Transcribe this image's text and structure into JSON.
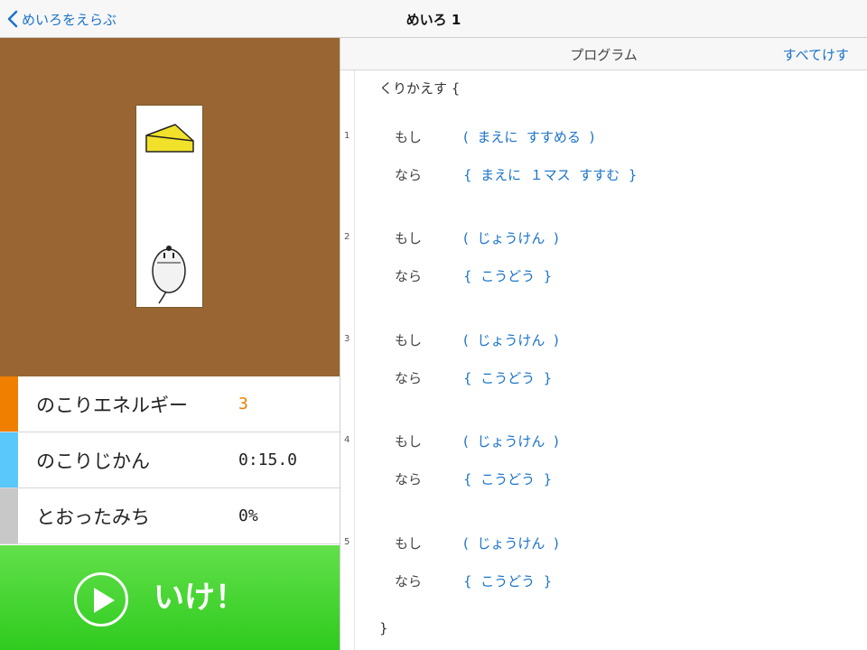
{
  "nav": {
    "back_label": "めいろをえらぶ",
    "title": "めいろ 1"
  },
  "stats": [
    {
      "label": "のこりエネルギー",
      "value": "3",
      "color": "#f07f00"
    },
    {
      "label": "のこりじかん",
      "value": "0:15.0",
      "color": "#5ac8fa"
    },
    {
      "label": "とおったみち",
      "value": "0%",
      "color": "#c8c8c8"
    }
  ],
  "go_button": {
    "label": "いけ！"
  },
  "program": {
    "header_title": "プログラム",
    "clear_label": "すべてけす",
    "loop_open": "くりかえす {",
    "loop_close": "}",
    "if_label": "もし",
    "then_label": "なら",
    "rules": [
      {
        "num": "1",
        "condition": "(  まえに  すすめる  )",
        "action": "{  まえに  １マス  すすむ  }"
      },
      {
        "num": "2",
        "condition": "(  じょうけん  )",
        "action": "{  こうどう  }"
      },
      {
        "num": "3",
        "condition": "(  じょうけん  )",
        "action": "{  こうどう  }"
      },
      {
        "num": "4",
        "condition": "(  じょうけん  )",
        "action": "{  こうどう  }"
      },
      {
        "num": "5",
        "condition": "(  じょうけん  )",
        "action": "{  こうどう  }"
      }
    ]
  },
  "colors": {
    "board": "#996633",
    "accent": "#1a73c9",
    "go": "#3dd22a",
    "cheese": "#f2e12a"
  }
}
